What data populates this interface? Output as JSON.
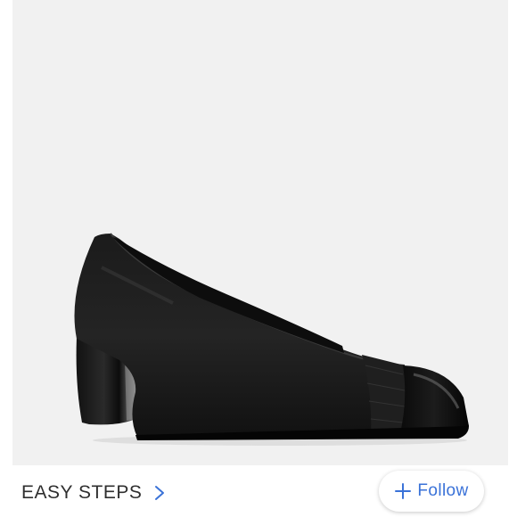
{
  "listing": {
    "photo": {
      "alt_icon": "shoe-photo",
      "background": "#f1f1f1"
    }
  },
  "seller": {
    "name": "EASY STEPS",
    "chevron_icon": "chevron-right-icon"
  },
  "follow": {
    "label": "Follow",
    "icon": "plus-icon",
    "color": "#3a72d8"
  }
}
